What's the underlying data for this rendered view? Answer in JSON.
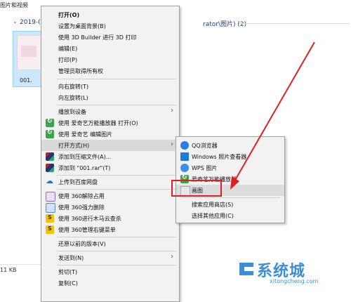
{
  "explorer": {
    "window_title": "图片和视频",
    "group_date": "2019-(",
    "group_suffix": "rator\\图片) (2)",
    "thumb_label": "001.",
    "status_size": "11 KB"
  },
  "context_menu": {
    "items": [
      {
        "label": "打开(O)",
        "bold": true
      },
      {
        "label": "设置为桌面背景(B)"
      },
      {
        "label": "使用 3D Builder 进行 3D 打印"
      },
      {
        "label": "编辑(E)"
      },
      {
        "label": "打印(P)"
      },
      {
        "label": "管理员取得所有权"
      },
      {
        "label": "向右旋转(T)"
      },
      {
        "label": "向左旋转(L)"
      },
      {
        "label": "播放到设备"
      },
      {
        "label": "使用 爱奇艺万能播放器 打开(O)",
        "icon": "iqiyi-player-icon"
      },
      {
        "label": "使用 爱奇艺 编辑图片",
        "icon": "iqiyi-edit-icon"
      },
      {
        "label": "打开方式(H)"
      },
      {
        "label": "添加到压缩文件(A)...",
        "icon": "winrar-icon"
      },
      {
        "label": "添加到 \"001.rar\"(T)",
        "icon": "winrar-icon"
      },
      {
        "label": "上传到百度网盘",
        "icon": "baidu-netdisk-icon"
      },
      {
        "label": "使用 360解除占用",
        "icon": "360-unlock-icon"
      },
      {
        "label": "使用 360强力删除",
        "icon": "360-delete-icon"
      },
      {
        "label": "使用 360进行木马云查杀",
        "icon": "360-scan-icon"
      },
      {
        "label": "使用 360管理右键菜单",
        "icon": "360-manage-icon"
      },
      {
        "label": "还原以前的版本(V)"
      },
      {
        "label": "发送到(N)"
      },
      {
        "label": "剪切(T)"
      },
      {
        "label": "复制(C)"
      }
    ]
  },
  "submenu": {
    "items": [
      {
        "label": "QQ浏览器",
        "icon": "qq-browser-icon"
      },
      {
        "label": "Windows 照片查看器",
        "icon": "windows-photo-viewer-icon"
      },
      {
        "label": "WPS 图片",
        "icon": "wps-image-icon"
      },
      {
        "label": "爱奇艺万能播放器",
        "icon": "iqiyi-player-icon"
      },
      {
        "label": "画图",
        "icon": "paint-icon"
      },
      {
        "label": "搜索应用商店(S)"
      },
      {
        "label": "选择其他应用(C)"
      }
    ]
  },
  "watermark": {
    "brand": "系统城",
    "url": "xitongcheng.com"
  },
  "colors": {
    "annotation_red": "#e02020",
    "menu_bg": "#f2f2f2",
    "highlight": "#d9d9d9",
    "watermark_blue": "#3a8fd8"
  }
}
